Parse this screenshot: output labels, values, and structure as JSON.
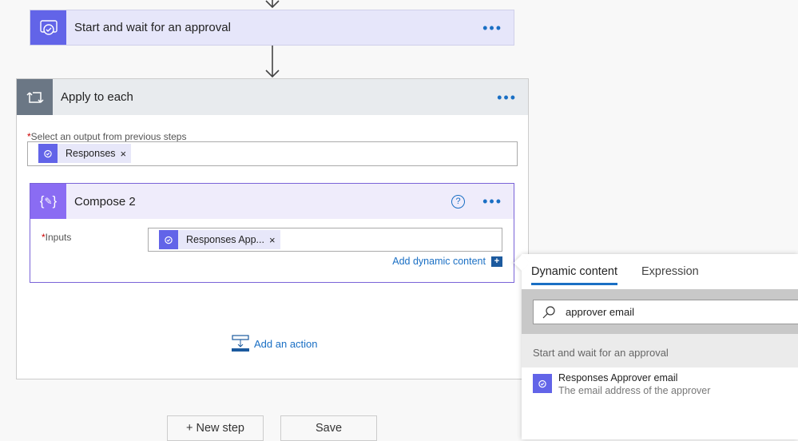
{
  "approval_card": {
    "title": "Start and wait for an approval",
    "icon": "approval-icon",
    "more": "more-options-icon"
  },
  "apply_card": {
    "title": "Apply to each",
    "icon": "loop-icon",
    "field_label": "Select an output from previous steps",
    "token": "Responses",
    "add_action": "Add an action"
  },
  "compose_card": {
    "title": "Compose 2",
    "icon": "compose-icon",
    "field_label": "Inputs",
    "token": "Responses App...",
    "add_dynamic": "Add dynamic content"
  },
  "footer": {
    "new_step": "+ New step",
    "save": "Save"
  },
  "dynamic_panel": {
    "tabs": [
      {
        "label": "Dynamic content",
        "active": true
      },
      {
        "label": "Expression",
        "active": false
      }
    ],
    "search_value": "approver email",
    "section": "Start and wait for an approval",
    "items": [
      {
        "title": "Responses Approver email",
        "description": "The email address of the approver"
      }
    ]
  },
  "colors": {
    "approval": "#6264e8",
    "compose": "#8a6cf3",
    "loop": "#6b7785",
    "link": "#1a6fc4"
  }
}
